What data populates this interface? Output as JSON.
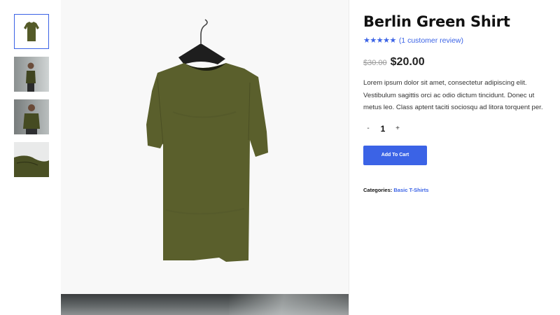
{
  "product": {
    "title": "Berlin Green Shirt",
    "rating_stars": "★★★★★",
    "rating_value": 5,
    "review_link": "(1 customer review)",
    "old_price": "$30.00",
    "price": "$20.00",
    "description": "Lorem ipsum dolor sit amet, consectetur adipiscing elit. Vestibulum sagittis orci ac odio dictum tincidunt. Donec ut metus leo. Class aptent taciti sociosqu ad litora torquent per.",
    "quantity": "1",
    "minus_label": "-",
    "plus_label": "+",
    "add_to_cart_label": "Add To Cart",
    "categories_label": "Categories:",
    "category": "Basic T-Shirts"
  },
  "gallery": {
    "thumbnails": [
      "shirt-flat",
      "model-side",
      "model-front",
      "fabric-detail"
    ],
    "active_index": 0
  },
  "colors": {
    "accent": "#3b63e6",
    "shirt": "#5a5f2c"
  }
}
